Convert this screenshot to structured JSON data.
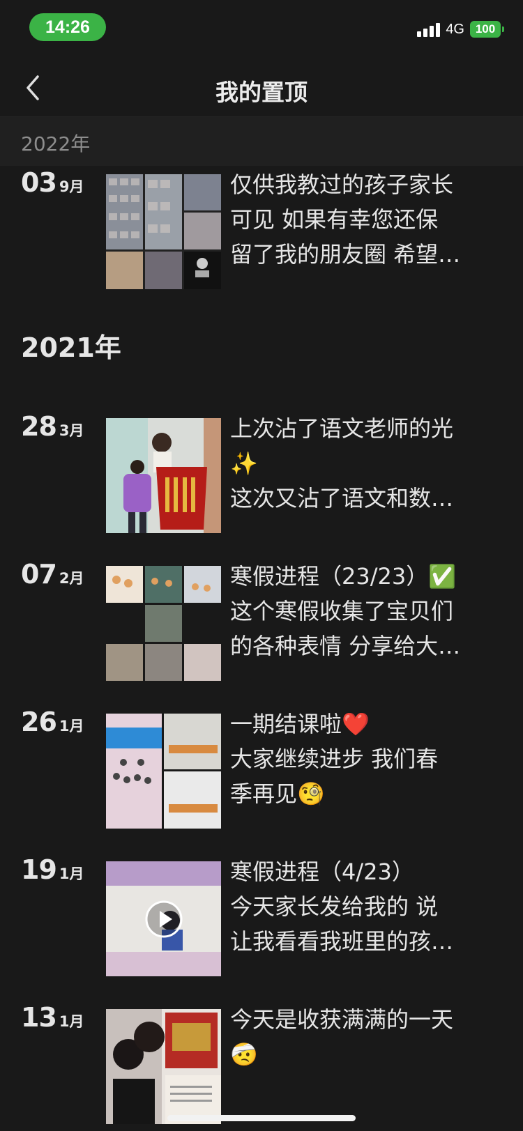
{
  "status_bar": {
    "time": "14:26",
    "network": "4G",
    "battery": "100"
  },
  "nav": {
    "title": "我的置顶"
  },
  "sticky_year": "2022年",
  "year_2021": "2021年",
  "entries": [
    {
      "day": "03",
      "month": "9月",
      "lines": [
        "仅供我教过的孩子家长",
        "可见 如果有幸您还保",
        "留了我的朋友圈 希望…"
      ]
    },
    {
      "day": "28",
      "month": "3月",
      "lines": [
        "上次沾了语文老师的光",
        "✨",
        "这次又沾了语文和数…"
      ]
    },
    {
      "day": "07",
      "month": "2月",
      "lines": [
        "寒假进程（23/23）✅",
        "这个寒假收集了宝贝们",
        "的各种表情 分享给大…"
      ]
    },
    {
      "day": "26",
      "month": "1月",
      "lines": [
        "一期结课啦❤️",
        "大家继续进步 我们春",
        "季再见🧐"
      ]
    },
    {
      "day": "19",
      "month": "1月",
      "lines": [
        "寒假进程（4/23）",
        "今天家长发给我的 说",
        "让我看看我班里的孩…"
      ]
    },
    {
      "day": "13",
      "month": "1月",
      "lines": [
        "今天是收获满满的一天",
        "🤕"
      ]
    }
  ],
  "icons": {
    "back": "chevron-left-icon",
    "play": "play-icon"
  },
  "colors": {
    "background": "#191919",
    "accent_green": "#3bb346"
  }
}
